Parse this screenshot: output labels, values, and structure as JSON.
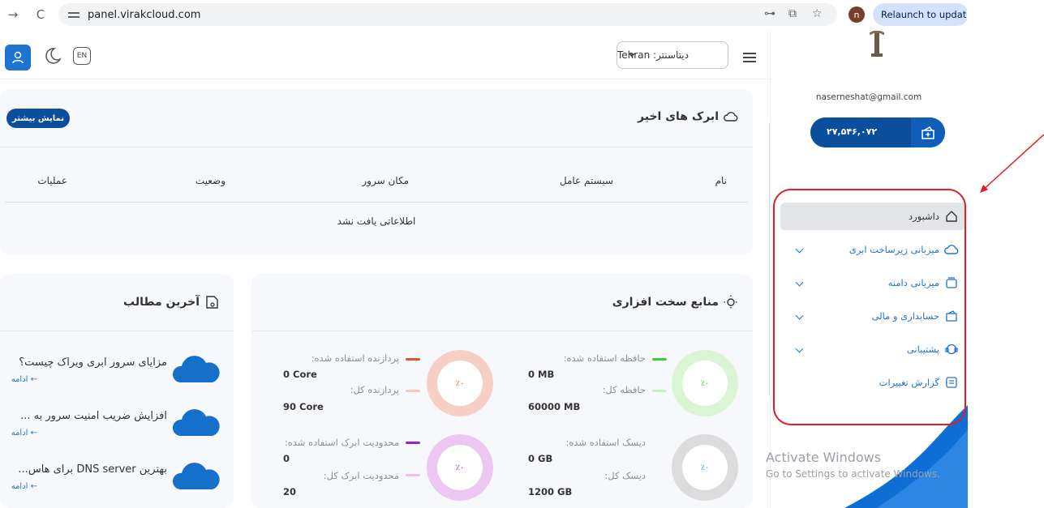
{
  "browser": {
    "url": "panel.virakcloud.com",
    "profile_initial": "n",
    "relaunch_label": "Relaunch to update"
  },
  "header": {
    "lang_label": "EN",
    "datacenter_label": "دیتاسنتر: Tehran"
  },
  "recent_clouds": {
    "title": "ابرک های اخیر",
    "more_button": "نمایش بیشتر",
    "columns": [
      "نام",
      "سیستم عامل",
      "مکان سرور",
      "وضعیت",
      "عملیات"
    ],
    "empty_text": "اطلاعاتی یافت نشد"
  },
  "hardware": {
    "title": "منابع سخت افزاری",
    "memory": {
      "used_label": "حافظه استفاده شده:",
      "used_value": "0 MB",
      "total_label": "حافظه کل:",
      "total_value": "60000 MB",
      "percent": "٪۰",
      "color": "#3ec93e"
    },
    "cpu": {
      "used_label": "پردازنده استفاده شده:",
      "used_value": "0 Core",
      "total_label": "پردازنده کل:",
      "total_value": "90 Core",
      "percent": "٪۰",
      "color": "#e2532b"
    },
    "disk": {
      "used_label": "دیسک استفاده شده:",
      "used_value": "0 GB",
      "total_label": "دیسک کل:",
      "total_value": "1200 GB",
      "percent": "٪۰",
      "color": "#1e9be0"
    },
    "cloud_limit": {
      "used_label": "محدودیت ابرک استفاده شده:",
      "used_value": "0",
      "total_label": "محدودیت ابرک کل:",
      "total_value": "20",
      "percent": "٪۰",
      "color": "#a020c8"
    }
  },
  "posts": {
    "title": "آخرین مطالب",
    "items": [
      {
        "title": "مزایای سرور ابری ویراک چیست؟",
        "more": "ادامه ←"
      },
      {
        "title": "افزایش ضریب امنیت سرور به ...",
        "more": "ادامه ←"
      },
      {
        "title": "بهترین DNS server برای هاس...",
        "more": "ادامه ←"
      }
    ]
  },
  "sidebar": {
    "email": "naserneshat@gmail.com",
    "wallet_amount": "۲۷,۵۴۶,۰۷۲",
    "items": [
      {
        "label": "داشبورد",
        "icon": "home-icon"
      },
      {
        "label": "میزبانی زیرساخت ابری",
        "icon": "cloud-icon"
      },
      {
        "label": "میزبانی دامنه",
        "icon": "dns-icon"
      },
      {
        "label": "حسابداری و مالی",
        "icon": "wallet-icon"
      },
      {
        "label": "پشتیبانی",
        "icon": "support-icon"
      },
      {
        "label": "گزارش تغییرات",
        "icon": "changelog-icon"
      }
    ]
  },
  "watermark": {
    "line1": "Activate Windows",
    "line2": "Go to Settings to activate Windows."
  },
  "colors": {
    "primary": "#0b4f9c",
    "accent": "#1e74d2",
    "highlight": "#e31b23"
  }
}
